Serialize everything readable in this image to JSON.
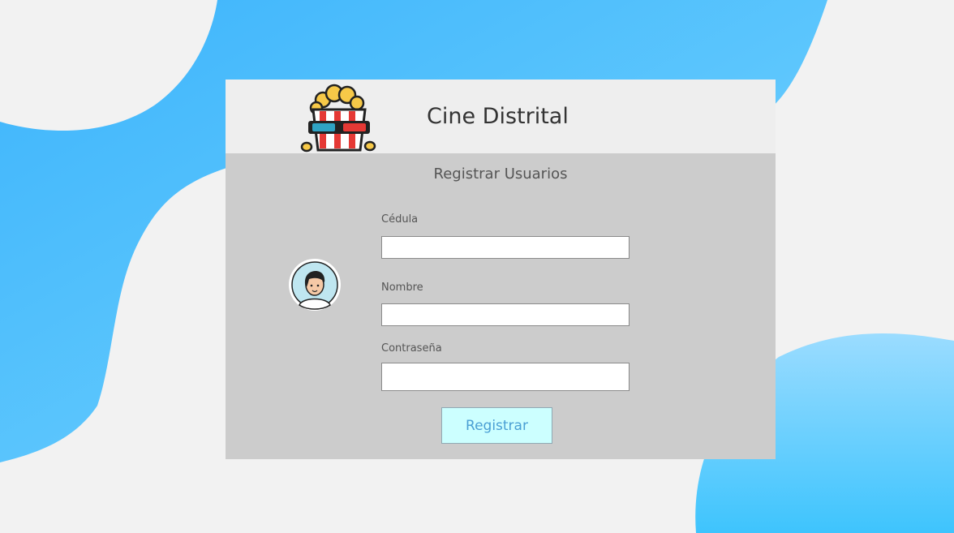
{
  "brand": {
    "title": "Cine Distrital",
    "logo_icon": "popcorn-3d-glasses-icon"
  },
  "form": {
    "title": "Registrar Usuarios",
    "avatar_icon": "user-avatar-icon",
    "fields": [
      {
        "label": "Cédula",
        "value": "",
        "placeholder": ""
      },
      {
        "label": "Nombre",
        "value": "",
        "placeholder": ""
      },
      {
        "label": "Contraseña",
        "value": "",
        "placeholder": ""
      }
    ],
    "submit_label": "Registrar"
  },
  "colors": {
    "background": "#f2f2f2",
    "blob_blue": "#4fc0fb",
    "card": "#cccccc",
    "card_header": "#eeeeee",
    "button_bg": "#ccffff",
    "button_text": "#4a9fd4"
  }
}
